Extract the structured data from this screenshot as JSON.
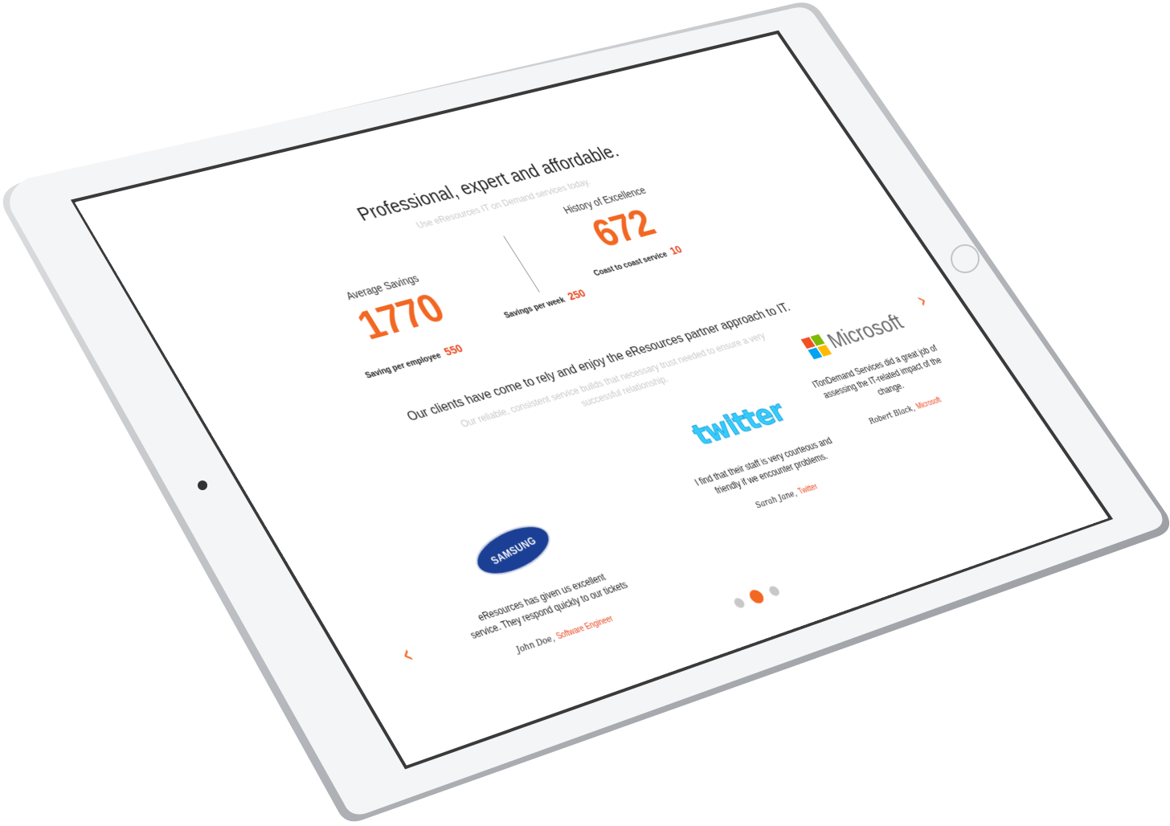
{
  "hero": {
    "title": "Professional, expert and affordable.",
    "subtitle": "Use eResources IT on Demand services today."
  },
  "stats": [
    {
      "label": "Average Savings",
      "value": "1770",
      "sub_label": "Saving per employee",
      "sub_value": "550"
    },
    {
      "label": "History of Excellence",
      "value": "672",
      "sub_label": "Coast to coast service",
      "sub_value": "10"
    },
    {
      "label": "",
      "value": "",
      "sub_label": "Savings per week",
      "sub_value": "250"
    }
  ],
  "clients": {
    "title": "Our clients have come to rely and enjoy the eResources partner approach to IT.",
    "subtitle": "Our reliable, consistent service builds that necessary trust needed to ensure a very successful relationship."
  },
  "testimonials": [
    {
      "logo": "SAMSUNG",
      "quote": "eResources has given us excellent service. They respond quickly to our tickets",
      "author": "John Doe,",
      "role": "Software Engineer"
    },
    {
      "logo": "twitter",
      "quote": "I find that their staff is very courteous and friendly if we encounter problems.",
      "author": "Sarah Jane,",
      "role": "Twitter"
    },
    {
      "logo": "Microsoft",
      "quote": "ITonDemand Services did a great job of assessing the IT-related impact of the change.",
      "author": "Robert Black,",
      "role": "Microsoft"
    }
  ],
  "carousel": {
    "prev_icon": "chevron-left-icon",
    "next_icon": "chevron-right-icon",
    "active_index": 1,
    "count": 3
  },
  "colors": {
    "accent": "#f26722",
    "accent_dark": "#e8441c",
    "muted": "#c9c9c9",
    "frame": "#f4f5f6"
  }
}
